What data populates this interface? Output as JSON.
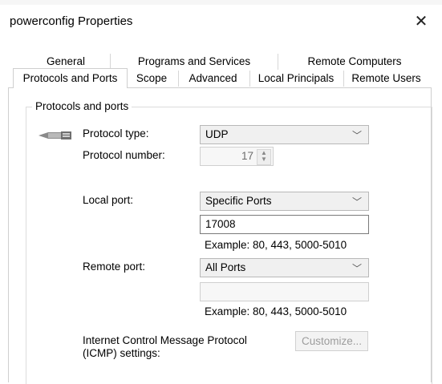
{
  "dialog": {
    "title": "powerconfig Properties",
    "close_glyph": "✕"
  },
  "tabs": {
    "row1": [
      "General",
      "Programs and Services",
      "Remote Computers"
    ],
    "row2": [
      "Protocols and Ports",
      "Scope",
      "Advanced",
      "Local Principals",
      "Remote Users"
    ],
    "active": "Protocols and Ports"
  },
  "group": {
    "label": "Protocols and ports"
  },
  "protocol_type": {
    "label": "Protocol type:",
    "value": "UDP"
  },
  "protocol_number": {
    "label": "Protocol number:",
    "value": "17"
  },
  "local_port": {
    "label": "Local port:",
    "mode": "Specific Ports",
    "value": "17008",
    "example": "Example: 80, 443, 5000-5010"
  },
  "remote_port": {
    "label": "Remote port:",
    "mode": "All Ports",
    "value": "",
    "example": "Example: 80, 443, 5000-5010"
  },
  "icmp": {
    "label_line1": "Internet Control Message Protocol",
    "label_line2": "(ICMP) settings:",
    "button": "Customize..."
  },
  "icons": {
    "protocol": "network-cable-icon",
    "dropdown": "chevron-down-icon"
  }
}
